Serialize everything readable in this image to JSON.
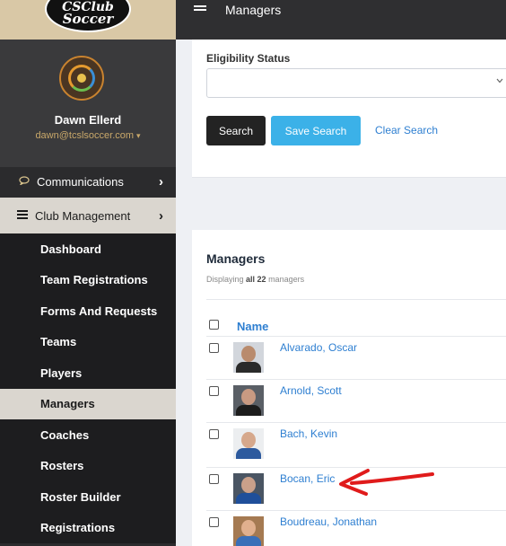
{
  "brand": {
    "logo_line1": "CSClub",
    "logo_line2": "Soccer"
  },
  "profile": {
    "name": "Dawn Ellerd",
    "email": "dawn@tcslsoccer.com",
    "caret": "▾"
  },
  "nav": {
    "communications": {
      "label": "Communications",
      "icon": "speech-bubble-icon",
      "chevron": "›"
    },
    "club_management": {
      "label": "Club Management",
      "icon": "list-icon",
      "chevron": "›"
    },
    "menu": [
      {
        "label": "Dashboard",
        "active": false
      },
      {
        "label": "Team Registrations",
        "active": false
      },
      {
        "label": "Forms And Requests",
        "active": false
      },
      {
        "label": "Teams",
        "active": false
      },
      {
        "label": "Players",
        "active": false
      },
      {
        "label": "Managers",
        "active": true
      },
      {
        "label": "Coaches",
        "active": false
      },
      {
        "label": "Rosters",
        "active": false
      },
      {
        "label": "Roster Builder",
        "active": false
      },
      {
        "label": "Registrations",
        "active": false
      }
    ]
  },
  "topbar": {
    "title": "Managers"
  },
  "filters": {
    "eligibility_label": "Eligibility Status",
    "eligibility_value": "",
    "search_label": "Search",
    "save_search_label": "Save Search",
    "clear_search_label": "Clear Search"
  },
  "managers": {
    "title": "Managers",
    "displaying_prefix": "Displaying ",
    "displaying_bold": "all 22",
    "displaying_suffix": " managers",
    "column_name": "Name",
    "rows": [
      {
        "name": "Alvarado, Oscar"
      },
      {
        "name": "Arnold, Scott"
      },
      {
        "name": "Bach, Kevin"
      },
      {
        "name": "Bocan, Eric"
      },
      {
        "name": "Boudreau, Jonathan"
      }
    ]
  },
  "colors": {
    "sidebar": "#2b2b2d",
    "active_item": "#dad6cf",
    "accent_blue": "#3bb1e8",
    "link_blue": "#2e7fd1",
    "arrow_red": "#e01b1b"
  }
}
